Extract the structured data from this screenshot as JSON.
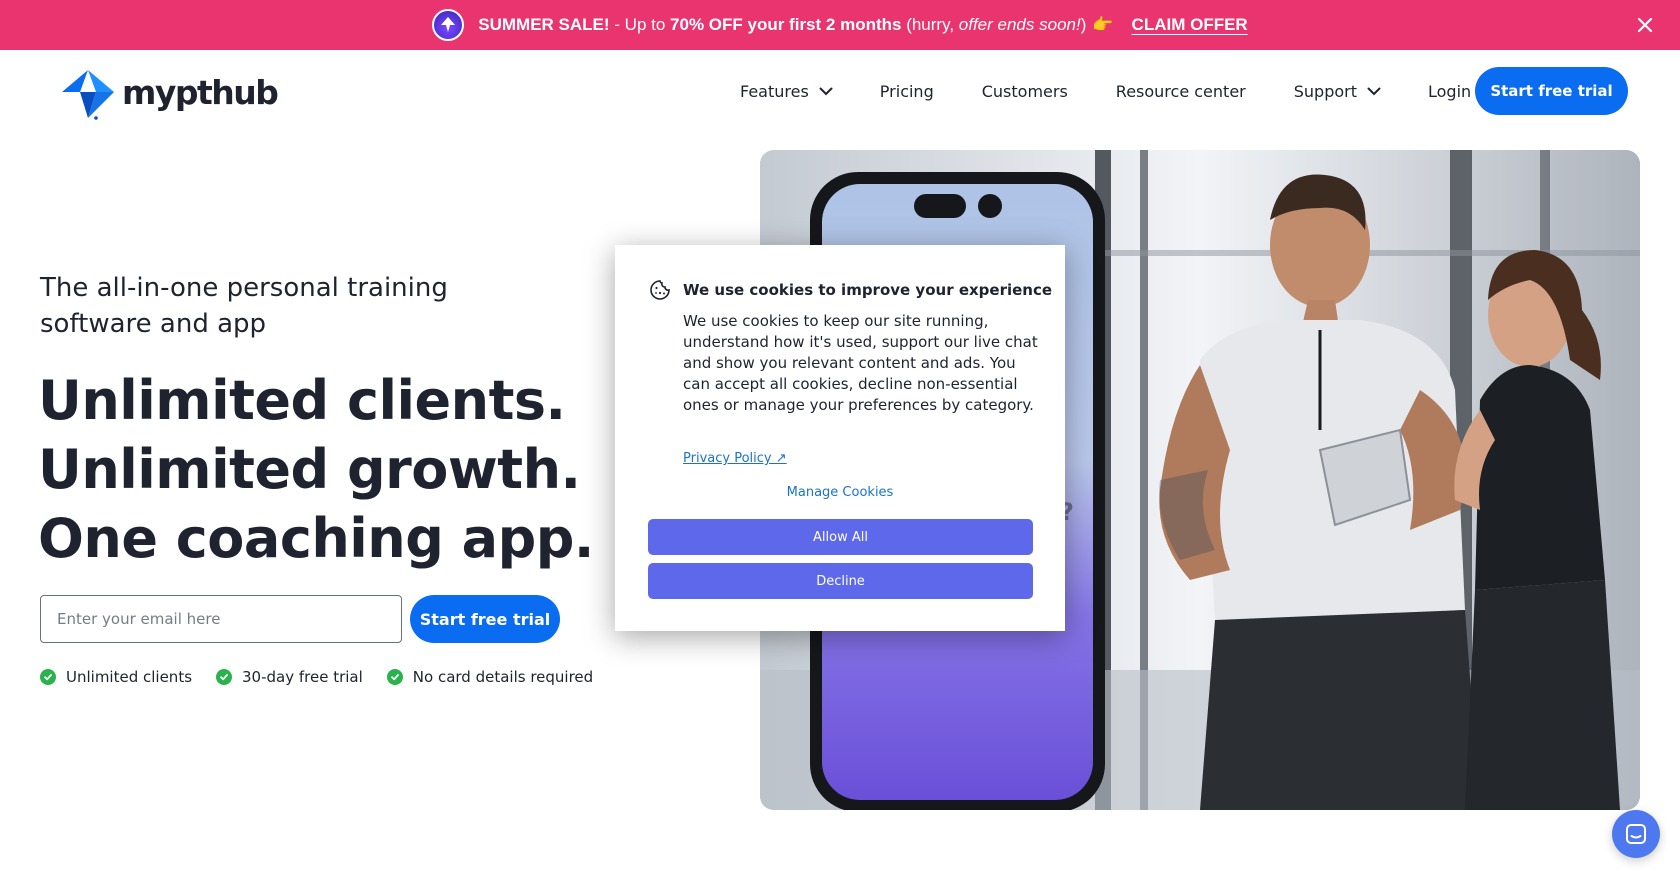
{
  "promo": {
    "sale_label": "SUMMER SALE!",
    "text_1": " - Up to ",
    "highlight": "70% OFF your first 2 months",
    "text_2": " (hurry, ",
    "italic": "offer ends soon!",
    "text_3": ")",
    "emoji": "👉",
    "cta": "CLAIM OFFER",
    "background": "#ea3470",
    "close_icon": "close-icon"
  },
  "header": {
    "logo_text": "mypthub",
    "nav": {
      "features": "Features",
      "pricing": "Pricing",
      "customers": "Customers",
      "resource_center": "Resource center",
      "support": "Support",
      "login": "Login"
    },
    "cta": "Start free trial"
  },
  "hero": {
    "tagline": "The all-in-one personal training software and app",
    "headline": [
      "Unlimited clients.",
      "Unlimited growth.",
      "One coaching app."
    ],
    "email_placeholder": "Enter your email here",
    "cta": "Start free trial",
    "benefits": [
      "Unlimited clients",
      "30-day free trial",
      "No card details required"
    ]
  },
  "cookie_modal": {
    "title": "We use cookies to improve your experience",
    "body": "We use cookies to keep our site running, understand how it's used, support our live chat and show you relevant content and ads. You can accept all cookies, decline non-essential ones or manage your preferences by category.",
    "privacy_link": "Privacy Policy ↗",
    "manage": "Manage Cookies",
    "allow": "Allow All",
    "decline": "Decline",
    "button_color": "#5d69ea"
  },
  "colors": {
    "primary": "#0a6cf0",
    "check": "#2ab24c",
    "text": "#1f2330"
  }
}
